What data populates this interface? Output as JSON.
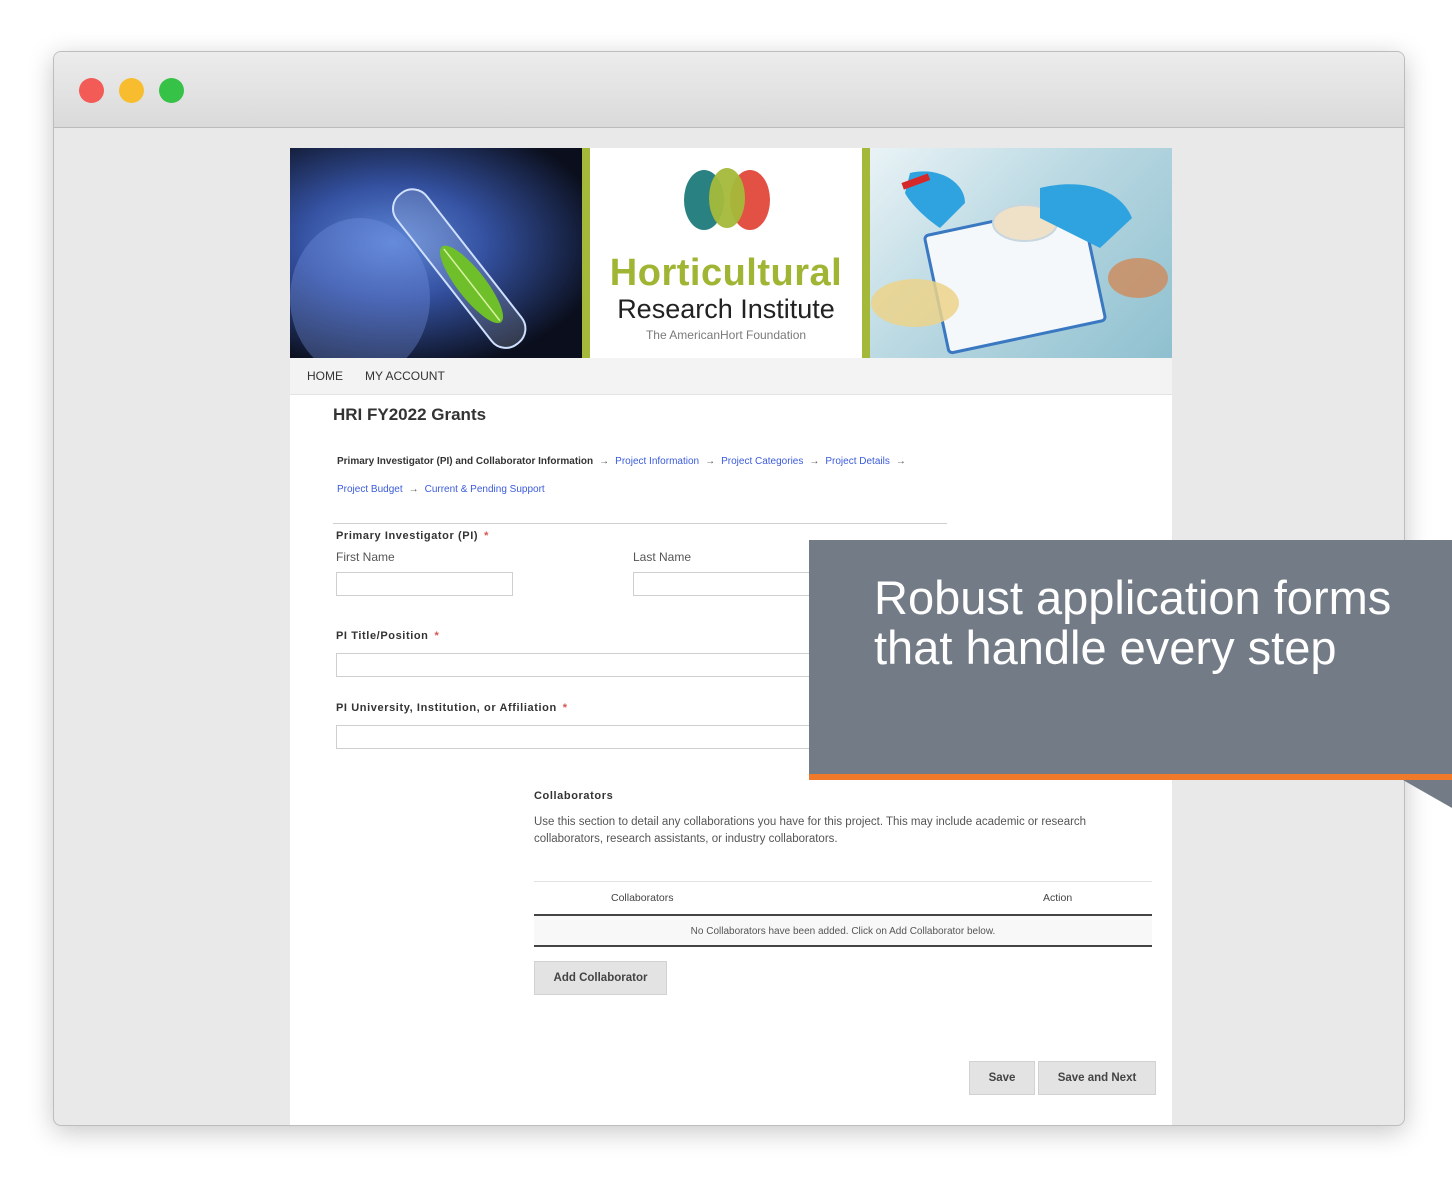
{
  "window": {
    "controls": [
      "close",
      "minimize",
      "zoom"
    ]
  },
  "banner": {
    "org_name_line1": "Horticultural",
    "org_name_line2": "Research Institute",
    "org_tagline": "The AmericanHort Foundation",
    "logo_colors": [
      "#1d7a7a",
      "#a4b93a",
      "#e2483a"
    ]
  },
  "nav": {
    "items": [
      "HOME",
      "MY ACCOUNT"
    ]
  },
  "page": {
    "title": "HRI FY2022 Grants"
  },
  "steps": {
    "current": "Primary Investigator (PI) and Collaborator Information",
    "links": [
      "Project Information",
      "Project Categories",
      "Project Details",
      "Project Budget",
      "Current & Pending Support"
    ],
    "arrow": "→"
  },
  "form": {
    "pi_label": "Primary Investigator (PI)",
    "first_name_label": "First Name",
    "last_name_label": "Last Name",
    "first_name_value": "",
    "last_name_value": "",
    "title_label": "PI Title/Position",
    "title_value": "",
    "affiliation_label": "PI University, Institution, or Affiliation",
    "affiliation_value": "",
    "required_marker": "*"
  },
  "collaborators": {
    "heading": "Collaborators",
    "description": "Use this section to detail any collaborations you have for this project. This may include academic or research collaborators, research assistants, or industry collaborators.",
    "columns": [
      "Collaborators",
      "Action"
    ],
    "empty_message": "No Collaborators have been added. Click on Add Collaborator below.",
    "add_button": "Add Collaborator"
  },
  "actions": {
    "save": "Save",
    "save_next": "Save and Next"
  },
  "callout": {
    "text": "Robust application forms that handle every step",
    "accent_color": "#f07a2a"
  }
}
